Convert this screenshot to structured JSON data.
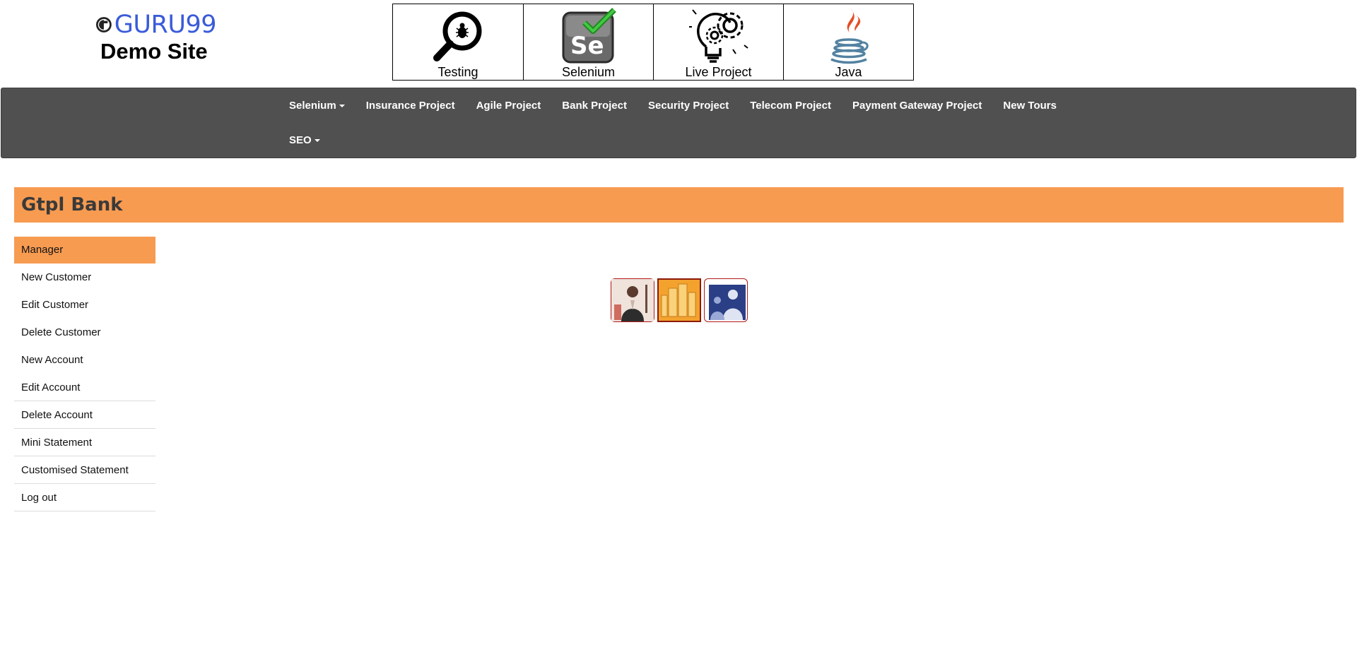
{
  "header": {
    "logo": {
      "brand": "GURU99",
      "subtitle": "Demo Site"
    },
    "tiles": [
      {
        "label": "Testing",
        "icon": "magnifier-bug-icon"
      },
      {
        "label": "Selenium",
        "icon": "selenium-check-icon"
      },
      {
        "label": "Live Project",
        "icon": "lightbulb-gear-icon"
      },
      {
        "label": "Java",
        "icon": "java-cup-icon"
      }
    ]
  },
  "navbar": {
    "row1": [
      "Selenium",
      "Insurance Project",
      "Agile Project",
      "Bank Project",
      "Security Project",
      "Telecom Project",
      "Payment Gateway Project",
      "New Tours"
    ],
    "row2": [
      "SEO"
    ]
  },
  "banner": {
    "title": "Gtpl Bank"
  },
  "sidebar": {
    "items": [
      "Manager",
      "New Customer",
      "Edit Customer",
      "Delete Customer",
      "New Account",
      "Edit Account",
      "Delete Account",
      "Mini Statement",
      "Customised Statement",
      "Log out"
    ]
  },
  "colors": {
    "accent": "#f79b51",
    "navbar": "#505050",
    "brand": "#3a5bd9"
  }
}
